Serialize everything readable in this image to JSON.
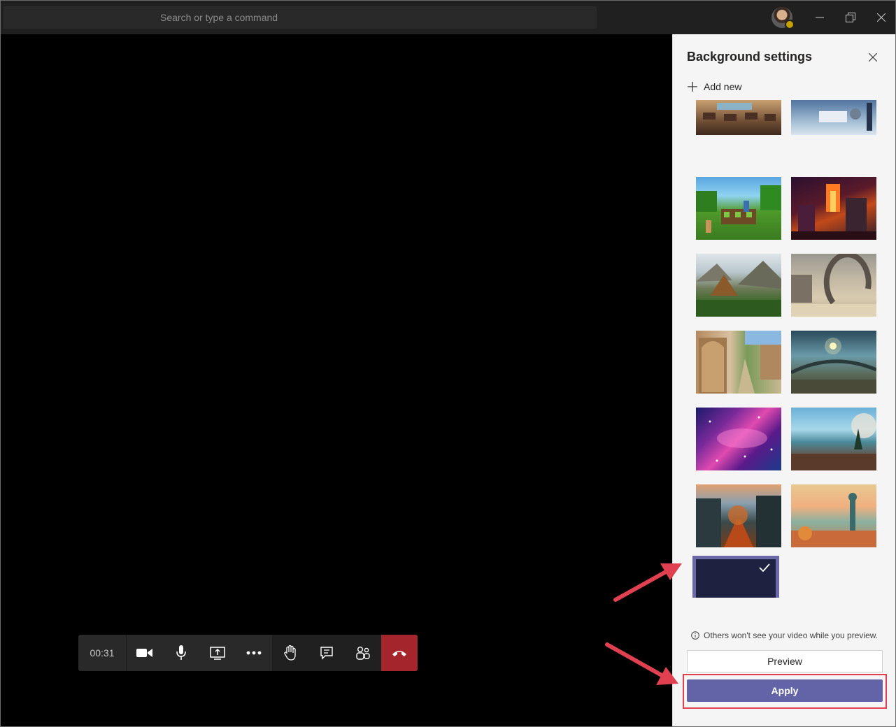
{
  "titlebar": {
    "search_placeholder": "Search or type a command",
    "icons": [
      "avatar",
      "minimize-icon",
      "restore-icon",
      "close-icon"
    ],
    "status_color": "#c5a000"
  },
  "call": {
    "timer": "00:31",
    "controls": [
      "camera-icon",
      "microphone-icon",
      "share-screen-icon",
      "more-options-icon",
      "raise-hand-icon",
      "chat-icon",
      "participants-icon",
      "hang-up-icon"
    ],
    "hangup_color": "#a4262c"
  },
  "panel": {
    "title": "Background settings",
    "add_new": "Add new",
    "thumbnails": [
      {
        "name": "classroom"
      },
      {
        "name": "sci-fi-interior"
      },
      {
        "name": "minecraft-farm"
      },
      {
        "name": "minecraft-nether"
      },
      {
        "name": "mountain-valley"
      },
      {
        "name": "desert-ruins-arch"
      },
      {
        "name": "fantasy-village-street"
      },
      {
        "name": "alien-planet-halo"
      },
      {
        "name": "galaxy-nebula"
      },
      {
        "name": "alien-shore-moon"
      },
      {
        "name": "autumn-village-street"
      },
      {
        "name": "cartoon-landscape"
      },
      {
        "name": "custom-dark-selected",
        "selected": true
      }
    ],
    "note": "Others won't see your video while you preview.",
    "preview_label": "Preview",
    "apply_label": "Apply",
    "accent_color": "#6264a7"
  },
  "annotations": {
    "color": "#e04050"
  }
}
